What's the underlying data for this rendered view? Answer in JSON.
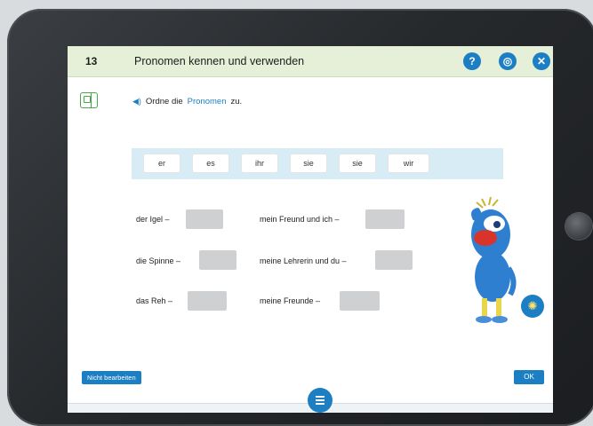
{
  "header": {
    "lesson_number": "13",
    "lesson_title": "Pronomen kennen und verwenden",
    "help_icon": "?",
    "notes_icon": "◎",
    "close_icon": "✕"
  },
  "instruction": {
    "prefix": "Ordne die",
    "link": "Pronomen",
    "suffix": "zu."
  },
  "word_bank": [
    "er",
    "es",
    "ihr",
    "sie",
    "sie",
    "wir"
  ],
  "sentences": {
    "left": [
      "der Igel –",
      "die Spinne –",
      "das Reh –"
    ],
    "right": [
      "mein Freund und ich –",
      "meine Lehrerin und du –",
      "meine Freunde –"
    ]
  },
  "footer": {
    "skip_label": "Nicht bearbeiten",
    "ok_label": "OK"
  },
  "colors": {
    "accent": "#1c7fc4",
    "header_bg": "#e6efd8",
    "word_bank_bg": "#d7ecf5",
    "blank": "#cfd0d2",
    "book_icon": "#49a64a"
  },
  "icons": [
    "help-icon",
    "notes-icon",
    "close-icon",
    "book-icon",
    "speaker-icon",
    "lightbulb-icon",
    "menu-icon"
  ]
}
